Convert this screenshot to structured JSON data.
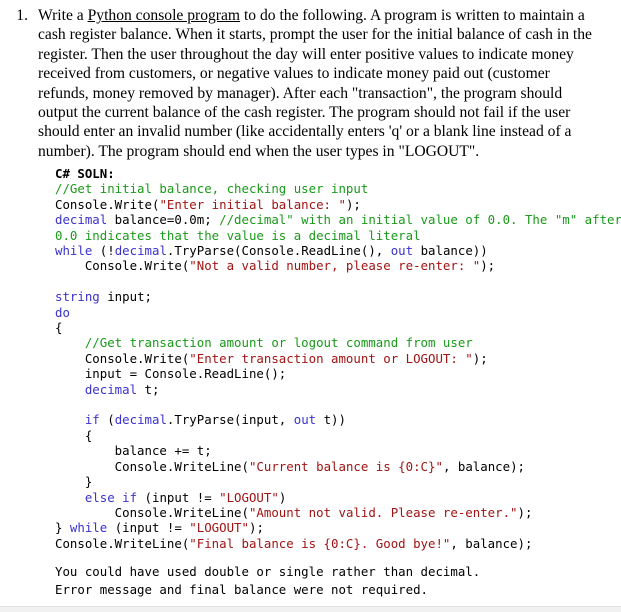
{
  "question": {
    "marker": "1.",
    "lead": "Write a ",
    "emphasis": "Python console program",
    "body": " to do the following. A program is written to maintain a cash register balance. When it starts, prompt the user for the initial balance of cash in the register. Then the user throughout the day will enter positive values to indicate money received from customers, or negative values to indicate money paid out (customer refunds, money removed by manager). After each \"transaction\", the program should output the current balance of the cash register. The program should not fail if the user should enter an invalid number (like accidentally enters 'q' or a blank line instead of a number). The program should end when the user types in \"LOGOUT\"."
  },
  "solution": {
    "heading": "C# SOLN:",
    "colors": {
      "comment": "#1a991a",
      "string": "#a01414",
      "keyword": "#3a32cc",
      "plain": "#000000"
    },
    "lines": [
      {
        "tokens": [
          {
            "t": "com",
            "s": "//Get initial balance, checking user input"
          }
        ]
      },
      {
        "tokens": [
          {
            "t": "pln",
            "s": "Console.Write("
          },
          {
            "t": "str",
            "s": "\"Enter initial balance: \""
          },
          {
            "t": "pln",
            "s": ");"
          }
        ]
      },
      {
        "tokens": [
          {
            "t": "kw",
            "s": "decimal"
          },
          {
            "t": "pln",
            "s": " balance=0.0m; "
          },
          {
            "t": "com",
            "s": "//decimal\" with an initial value of 0.0. The \"m\" after"
          }
        ]
      },
      {
        "tokens": [
          {
            "t": "com",
            "s": "0.0 indicates that the value is a decimal literal"
          }
        ]
      },
      {
        "tokens": [
          {
            "t": "kw",
            "s": "while"
          },
          {
            "t": "pln",
            "s": " (!"
          },
          {
            "t": "kw",
            "s": "decimal"
          },
          {
            "t": "pln",
            "s": ".TryParse(Console.ReadLine(), "
          },
          {
            "t": "kw",
            "s": "out"
          },
          {
            "t": "pln",
            "s": " balance))"
          }
        ]
      },
      {
        "tokens": [
          {
            "t": "pln",
            "s": "    Console.Write("
          },
          {
            "t": "str",
            "s": "\"Not a valid number, please re-enter: \""
          },
          {
            "t": "pln",
            "s": ");"
          }
        ]
      },
      {
        "blank": true,
        "tokens": []
      },
      {
        "tokens": [
          {
            "t": "kw",
            "s": "string"
          },
          {
            "t": "pln",
            "s": " input;"
          }
        ]
      },
      {
        "tokens": [
          {
            "t": "kw",
            "s": "do"
          }
        ]
      },
      {
        "tokens": [
          {
            "t": "pln",
            "s": "{"
          }
        ]
      },
      {
        "tokens": [
          {
            "t": "com",
            "s": "    //Get transaction amount or logout command from user"
          }
        ]
      },
      {
        "tokens": [
          {
            "t": "pln",
            "s": "    Console.Write("
          },
          {
            "t": "str",
            "s": "\"Enter transaction amount or LOGOUT: \""
          },
          {
            "t": "pln",
            "s": ");"
          }
        ]
      },
      {
        "tokens": [
          {
            "t": "pln",
            "s": "    input = Console.ReadLine();"
          }
        ]
      },
      {
        "tokens": [
          {
            "t": "pln",
            "s": "    "
          },
          {
            "t": "kw",
            "s": "decimal"
          },
          {
            "t": "pln",
            "s": " t;"
          }
        ]
      },
      {
        "blank": true,
        "tokens": []
      },
      {
        "tokens": [
          {
            "t": "pln",
            "s": "    "
          },
          {
            "t": "kw",
            "s": "if"
          },
          {
            "t": "pln",
            "s": " ("
          },
          {
            "t": "kw",
            "s": "decimal"
          },
          {
            "t": "pln",
            "s": ".TryParse(input, "
          },
          {
            "t": "kw",
            "s": "out"
          },
          {
            "t": "pln",
            "s": " t))"
          }
        ]
      },
      {
        "tokens": [
          {
            "t": "pln",
            "s": "    {"
          }
        ]
      },
      {
        "tokens": [
          {
            "t": "pln",
            "s": "        balance += t;"
          }
        ]
      },
      {
        "tokens": [
          {
            "t": "pln",
            "s": "        Console.WriteLine("
          },
          {
            "t": "str",
            "s": "\"Current balance is {0:C}\""
          },
          {
            "t": "pln",
            "s": ", balance);"
          }
        ]
      },
      {
        "tokens": [
          {
            "t": "pln",
            "s": "    }"
          }
        ]
      },
      {
        "tokens": [
          {
            "t": "pln",
            "s": "    "
          },
          {
            "t": "kw",
            "s": "else if"
          },
          {
            "t": "pln",
            "s": " (input != "
          },
          {
            "t": "str",
            "s": "\"LOGOUT\""
          },
          {
            "t": "pln",
            "s": ")"
          }
        ]
      },
      {
        "tokens": [
          {
            "t": "pln",
            "s": "        Console.WriteLine("
          },
          {
            "t": "str",
            "s": "\"Amount not valid. Please re-enter.\""
          },
          {
            "t": "pln",
            "s": ");"
          }
        ]
      },
      {
        "tokens": [
          {
            "t": "pln",
            "s": "} "
          },
          {
            "t": "kw",
            "s": "while"
          },
          {
            "t": "pln",
            "s": " (input != "
          },
          {
            "t": "str",
            "s": "\"LOGOUT\""
          },
          {
            "t": "pln",
            "s": ");"
          }
        ]
      },
      {
        "tokens": [
          {
            "t": "pln",
            "s": "Console.WriteLine("
          },
          {
            "t": "str",
            "s": "\"Final balance is {0:C}. Good bye!\""
          },
          {
            "t": "pln",
            "s": ", balance);"
          }
        ]
      }
    ]
  },
  "notes": {
    "lines": [
      "You could have used double or single rather than decimal.",
      "Error message and final balance were not required."
    ]
  }
}
